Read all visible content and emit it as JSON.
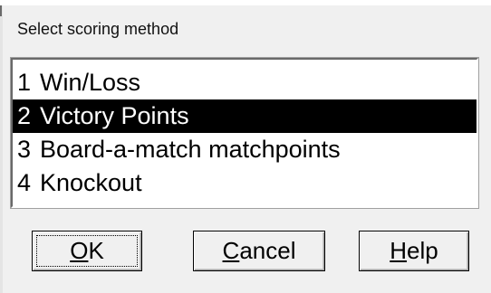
{
  "dialog": {
    "title": "Select scoring method"
  },
  "scoring_methods": {
    "selected_index": 1,
    "items": [
      {
        "number": "1",
        "label": "Win/Loss"
      },
      {
        "number": "2",
        "label": "Victory Points"
      },
      {
        "number": "3",
        "label": "Board-a-match matchpoints"
      },
      {
        "number": "4",
        "label": "Knockout"
      }
    ]
  },
  "buttons": {
    "ok": {
      "mnemonic": "O",
      "rest": "K"
    },
    "cancel": {
      "mnemonic": "C",
      "rest": "ancel"
    },
    "help": {
      "mnemonic": "H",
      "rest": "elp"
    }
  },
  "colors": {
    "dialog_background": "#f0f0f0",
    "list_background": "#ffffff",
    "selection_background": "#000000",
    "selection_text": "#ffffff"
  }
}
